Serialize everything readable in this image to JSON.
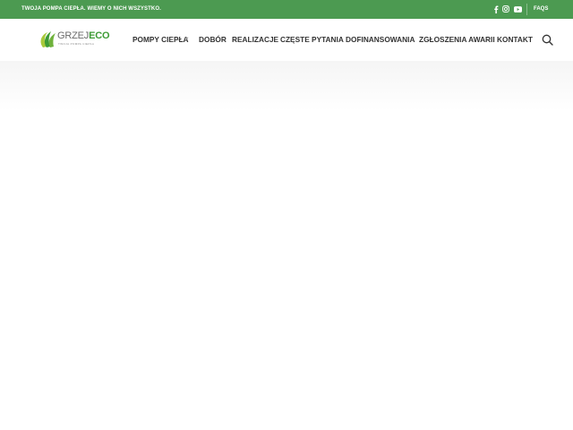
{
  "colors": {
    "topbar_bg": "#4c9a51",
    "logo_green": "#3d9b35",
    "logo_lime": "#a8c93a",
    "nav_text": "#333333"
  },
  "topbar": {
    "tagline": "TWOJA POMPA CIEPŁA. WIEMY O NICH WSZYSTKO.",
    "social_icons": [
      "facebook-icon",
      "instagram-icon",
      "youtube-icon"
    ],
    "faqs_label": "FAQS"
  },
  "logo": {
    "word_part1": "GRZEJ",
    "word_part2": "ECO",
    "tagline": "TWOJA POMPA CIEPŁA"
  },
  "nav": {
    "items": [
      {
        "label": "POMPY CIEPŁA",
        "has_dropdown": true
      },
      {
        "label": "DOBÓR"
      },
      {
        "label": "REALIZACJE"
      },
      {
        "label": "CZĘSTE PYTANIA"
      },
      {
        "label": "DOFINANSOWANIA"
      },
      {
        "label": "ZGŁOSZENIA AWARII"
      },
      {
        "label": "KONTAKT"
      }
    ],
    "search_icon": "search-icon",
    "dropdown_icon": "chevron-down-icon"
  }
}
